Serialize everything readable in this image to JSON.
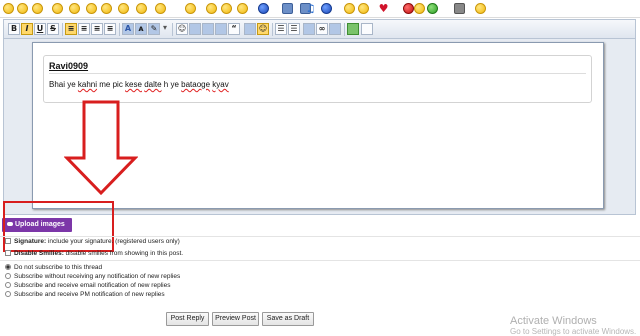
{
  "smilies": [
    "smile-icon",
    "smile-icon",
    "smile-icon",
    "smile-icon",
    "thumbs-up-icon",
    "smile-icon",
    "smile-icon",
    "star-icon",
    "smile-icon",
    "smile-icon",
    "smile-icon",
    "smile-icon",
    "smile-icon",
    "rocket-icon",
    "help-icon",
    "image-icon",
    "image-icon",
    "music-note-icon",
    "question-icon",
    "lightbulb-icon",
    "smile-icon",
    "heart-icon",
    "alert-icon",
    "smile-icon",
    "bug-icon",
    "film-icon",
    "smile-icon"
  ],
  "toolbar": {
    "bold": "B",
    "italic": "I",
    "underline": "U",
    "strike": "S",
    "font": "A"
  },
  "quote": {
    "author": "Ravi0909",
    "body_parts": [
      "Bhai ye ",
      "kahni",
      " me pic ",
      "kese",
      " ",
      "dalte",
      " h ye ",
      "bataoge",
      " ",
      "kyav"
    ]
  },
  "upload": {
    "label": "Upload images"
  },
  "options": {
    "signature_label": "Signature:",
    "signature_desc": "include your signature. (registered users only)",
    "disable_smilies_label": "Disable Smilies:",
    "disable_smilies_desc": "disable smilies from showing in this post."
  },
  "subscription": [
    {
      "label": "Do not subscribe to this thread",
      "checked": true
    },
    {
      "label": "Subscribe without receiving any notification of new replies",
      "checked": false
    },
    {
      "label": "Subscribe and receive email notification of new replies",
      "checked": false
    },
    {
      "label": "Subscribe and receive PM notification of new replies",
      "checked": false
    }
  ],
  "buttons": {
    "post_reply": "Post Reply",
    "preview_post": "Preview Post",
    "save_draft": "Save as Draft"
  },
  "watermark": {
    "line1": "Activate Windows",
    "line2": "Go to Settings to activate Windows."
  },
  "colors": {
    "upload_purple": "#7c36a8",
    "annotation_red": "#d81e1e"
  }
}
